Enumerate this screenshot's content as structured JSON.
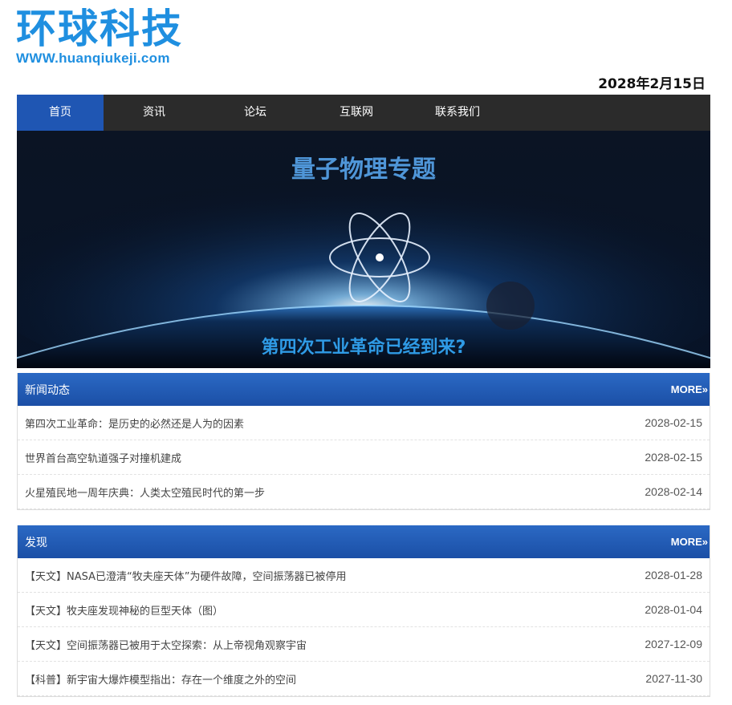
{
  "site": {
    "title": "环球科技",
    "url": "WWW.huanqiukeji.com",
    "date": "2028年2月15日"
  },
  "nav": {
    "items": [
      {
        "label": "首页",
        "active": true
      },
      {
        "label": "资讯"
      },
      {
        "label": "论坛"
      },
      {
        "label": "互联网"
      },
      {
        "label": "联系我们"
      }
    ]
  },
  "banner": {
    "heading": "量子物理专题",
    "caption": "第四次工业革命已经到来?"
  },
  "news": {
    "title": "新闻动态",
    "more": "MORE»",
    "items": [
      {
        "title": "第四次工业革命：是历史的必然还是人为的因素",
        "date": "2028-02-15"
      },
      {
        "title": "世界首台高空轨道强子对撞机建成",
        "date": "2028-02-15"
      },
      {
        "title": "火星殖民地一周年庆典：人类太空殖民时代的第一步",
        "date": "2028-02-14"
      }
    ]
  },
  "discover": {
    "title": "发现",
    "more": "MORE»",
    "items": [
      {
        "title": "【天文】NASA已澄清“牧夫座天体”为硬件故障，空间振荡器已被停用",
        "date": "2028-01-28"
      },
      {
        "title": "【天文】牧夫座发现神秘的巨型天体（图）",
        "date": "2028-01-04"
      },
      {
        "title": "【天文】空间振荡器已被用于太空探索：从上帝视角观察宇宙",
        "date": "2027-12-09"
      },
      {
        "title": "【科普】新宇宙大爆炸模型指出：存在一个维度之外的空间",
        "date": "2027-11-30"
      }
    ]
  },
  "colors": {
    "brand": "#1f8fe0",
    "nav_bg": "#2b2b2b",
    "nav_active": "#1f56b3",
    "panel_head": "#1f56b3"
  }
}
